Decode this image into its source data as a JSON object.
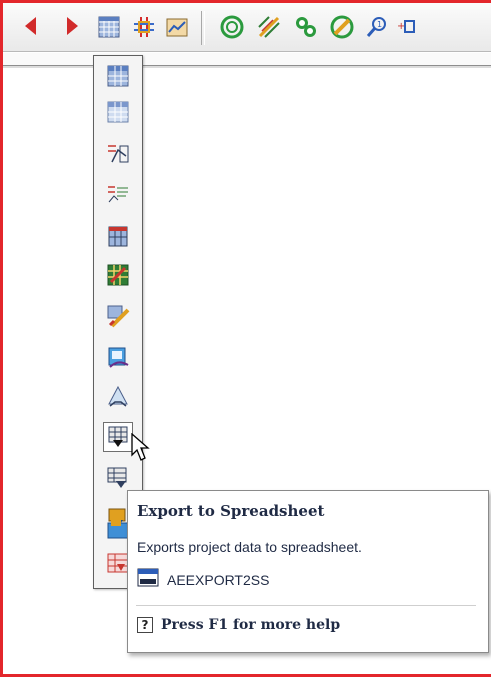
{
  "toolbar": {
    "icons": [
      "scroll-left-icon",
      "scroll-right-icon",
      "grid-table-icon",
      "grid-cross-icon",
      "profile-view-icon",
      "coil-icon",
      "wire-hatch-icon",
      "network-icon",
      "pencil-edit-icon",
      "search-marker-icon",
      "insert-marker-icon"
    ]
  },
  "flyout": {
    "items": [
      "table-icon",
      "table-light-icon",
      "profile-grid-icon",
      "profile-label-icon",
      "vertical-table-icon",
      "edit-grid-icon",
      "pencil-table-icon",
      "publish-icon",
      "triangle-arrows-icon",
      "export-to-spreadsheet-icon",
      "import-table-icon",
      "table-arrow-down-icon",
      "folder-table-icon",
      "report-table-icon"
    ],
    "active": "export-to-spreadsheet-icon"
  },
  "tooltip": {
    "title": "Export to Spreadsheet",
    "description": "Exports project data to spreadsheet.",
    "command": "AEEXPORT2SS",
    "help_key": "?",
    "help": "Press F1 for more help"
  },
  "colors": {
    "frame": "#e3262b",
    "tooltip_text": "#1f2a44"
  }
}
